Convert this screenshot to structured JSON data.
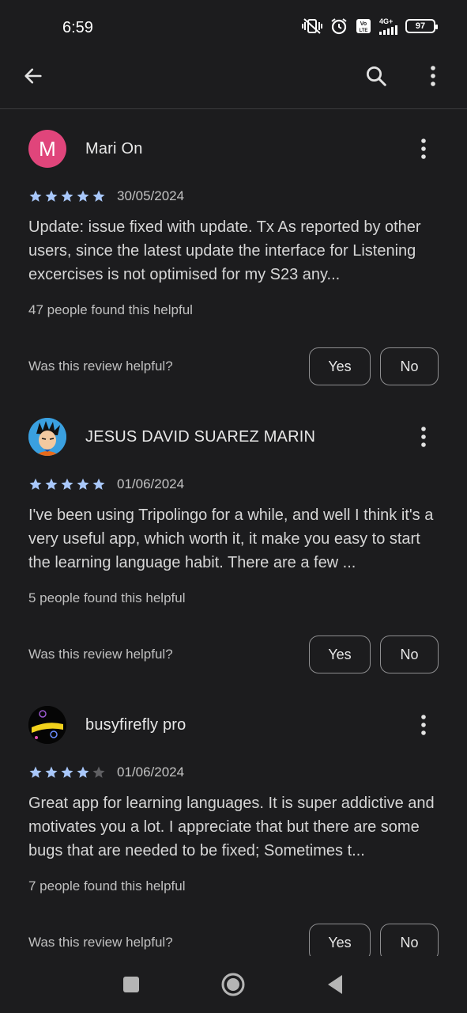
{
  "status_bar": {
    "time": "6:59",
    "network": "4G+",
    "battery": "97"
  },
  "app_bar": {
    "back_icon": "arrow-back-icon",
    "search_icon": "search-icon",
    "more_icon": "more-vert-icon"
  },
  "reviews": [
    {
      "avatar_letter": "M",
      "avatar_color": "#e0457b",
      "author": "Mari On",
      "rating": 5,
      "date": "30/05/2024",
      "text": "Update: issue fixed with update. Tx As reported by other users, since the latest update the interface for Listening excercises is not optimised for my S23 any...",
      "helpful_count": "47 people found this helpful",
      "helpful_question": "Was this review helpful?",
      "yes_label": "Yes",
      "no_label": "No"
    },
    {
      "avatar_letter": "",
      "author": "JESUS DAVID SUAREZ MARIN",
      "rating": 5,
      "date": "01/06/2024",
      "text": "I've been using Tripolingo for a while, and well I think it's a very useful app, which worth it, it make you easy to start the learning language habit. There are a few ...",
      "helpful_count": "5 people found this helpful",
      "helpful_question": "Was this review helpful?",
      "yes_label": "Yes",
      "no_label": "No"
    },
    {
      "avatar_letter": "",
      "author": "busyfirefly pro",
      "rating": 4,
      "date": "01/06/2024",
      "text": "Great app for learning languages. It is super addictive and motivates you a lot. I appreciate that but there are some bugs that are needed to be fixed; Sometimes t...",
      "helpful_count": "7 people found this helpful",
      "helpful_question": "Was this review helpful?",
      "yes_label": "Yes",
      "no_label": "No"
    }
  ],
  "colors": {
    "background": "#1c1c1e",
    "star_filled": "#a8c7fa",
    "star_empty": "#5f5f62"
  },
  "nav_bar": {
    "recents_icon": "square-recents-icon",
    "home_icon": "circle-home-icon",
    "back_icon": "triangle-back-icon"
  }
}
